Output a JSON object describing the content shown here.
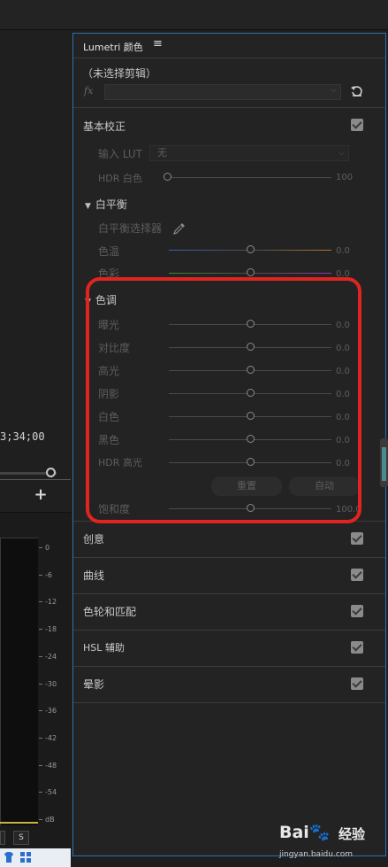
{
  "left": {
    "timecode": "3;34;00",
    "add_label": "+",
    "meter_scale": [
      "0",
      "-6",
      "-12",
      "-18",
      "-24",
      "-30",
      "-36",
      "-42",
      "-48",
      "-54",
      "dB"
    ],
    "ms_labels": [
      "",
      "S"
    ]
  },
  "panel": {
    "title": "Lumetri 颜色",
    "menu_icon": "≡",
    "clip_label": "（未选择剪辑）",
    "fx_label": "fx",
    "reset_icon": "reset-icon",
    "basic": {
      "title": "基本校正",
      "lut_label": "输入 LUT",
      "lut_value": "无",
      "hdr_white_label": "HDR 白色",
      "hdr_white_value": "100",
      "hdr_white_level": 0.0
    },
    "white_balance": {
      "title": "白平衡",
      "selector_label": "白平衡选择器",
      "rows": [
        {
          "label": "色温",
          "value": "0.0"
        },
        {
          "label": "色彩",
          "value": "0.0"
        }
      ]
    },
    "tone": {
      "title": "色调",
      "rows": [
        {
          "label": "曝光",
          "value": "0.0"
        },
        {
          "label": "对比度",
          "value": "0.0"
        },
        {
          "label": "高光",
          "value": "0.0"
        },
        {
          "label": "阴影",
          "value": "0.0"
        },
        {
          "label": "白色",
          "value": "0.0"
        },
        {
          "label": "黑色",
          "value": "0.0"
        },
        {
          "label": "HDR 高光",
          "value": "0.0"
        }
      ],
      "reset_label": "重置",
      "auto_label": "自动",
      "saturation_label": "饱和度",
      "saturation_value": "100.0"
    },
    "sections": [
      {
        "title": "创意"
      },
      {
        "title": "曲线"
      },
      {
        "title": "色轮和匹配"
      },
      {
        "title": "HSL 辅助"
      },
      {
        "title": "晕影"
      }
    ]
  },
  "watermark": {
    "logo": "Bai",
    "logo2": "经验",
    "url": "jingyan.baidu.com"
  },
  "colors": {
    "highlight": "#e0241f",
    "panel_border": "#2d6fb3",
    "temp_left": "#3b5fae",
    "temp_right": "#b07a2e",
    "tint_left": "#3a8a3a",
    "tint_right": "#9a3aa0"
  }
}
